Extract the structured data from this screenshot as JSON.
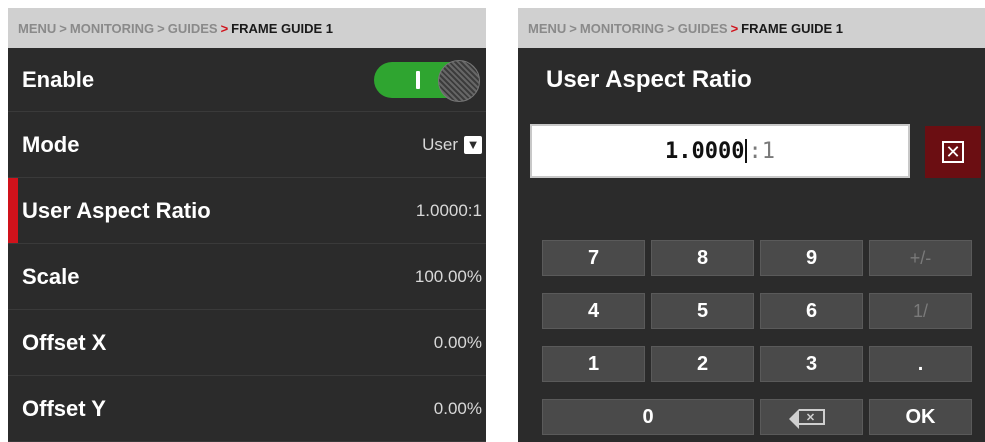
{
  "left": {
    "breadcrumb": {
      "items": [
        "MENU",
        "MONITORING",
        "GUIDES"
      ],
      "separator": ">",
      "current": "FRAME GUIDE 1"
    },
    "rows": [
      {
        "label": "Enable",
        "control": "toggle",
        "state": "on"
      },
      {
        "label": "Mode",
        "value": "User",
        "dropdown_icon": "chevron-down-icon"
      },
      {
        "label": "User Aspect Ratio",
        "value": "1.0000:1",
        "selected": true
      },
      {
        "label": "Scale",
        "value": "100.00%"
      },
      {
        "label": "Offset X",
        "value": "0.00%"
      },
      {
        "label": "Offset Y",
        "value": "0.00%"
      }
    ]
  },
  "right": {
    "breadcrumb": {
      "items": [
        "MENU",
        "MONITORING",
        "GUIDES"
      ],
      "separator": ">",
      "current": "FRAME GUIDE 1"
    },
    "title": "User Aspect Ratio",
    "input": {
      "value": "1.0000",
      "suffix": ":1"
    },
    "clear_icon": "close-box-icon",
    "keypad": [
      [
        "7",
        "8",
        "9",
        "+/-"
      ],
      [
        "4",
        "5",
        "6",
        "1/"
      ],
      [
        "1",
        "2",
        "3",
        "."
      ],
      [
        "0",
        "backspace",
        "OK"
      ]
    ]
  },
  "colors": {
    "accent_red": "#d0121b",
    "toggle_green": "#2fa530",
    "panel_bg": "#2b2b2b",
    "key_bg": "#4a4a4a"
  }
}
